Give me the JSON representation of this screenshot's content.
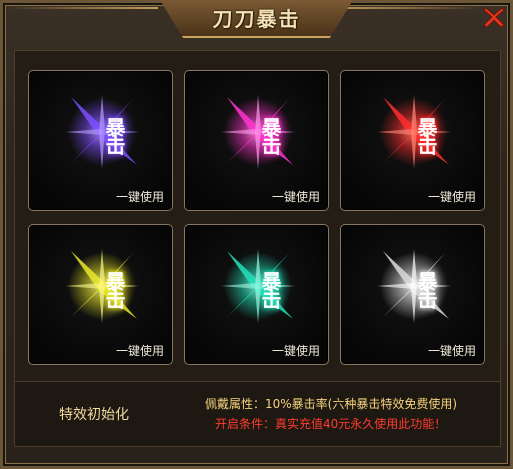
{
  "window": {
    "title": "刀刀暴击",
    "close_icon": "close-x-icon"
  },
  "cards": [
    {
      "label": "暴击",
      "button": "一键使用",
      "color": "#7b4dff",
      "glow": "#b99bff"
    },
    {
      "label": "暴击",
      "button": "一键使用",
      "color": "#ff33cc",
      "glow": "#ff9be8"
    },
    {
      "label": "暴击",
      "button": "一键使用",
      "color": "#ff2b2b",
      "glow": "#ff8c7a"
    },
    {
      "label": "暴击",
      "button": "一键使用",
      "color": "#e8e62a",
      "glow": "#fbf88a"
    },
    {
      "label": "暴击",
      "button": "一键使用",
      "color": "#21e0b8",
      "glow": "#9cf7e2"
    },
    {
      "label": "暴击",
      "button": "一键使用",
      "color": "#d9d9d9",
      "glow": "#ffffff"
    }
  ],
  "footer": {
    "reset_label": "特效初始化",
    "attribute_text": "佩戴属性：10%暴击率(六种暴击特效免费使用)",
    "condition_text": "开启条件：真实充值40元永久使用此功能！"
  }
}
